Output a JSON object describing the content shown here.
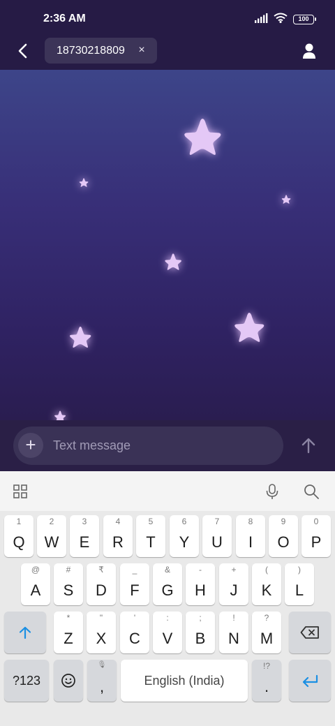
{
  "status_bar": {
    "time": "2:36 AM",
    "battery": "100"
  },
  "header": {
    "recipient": "18730218809",
    "remove_symbol": "×"
  },
  "composer": {
    "placeholder": "Text message",
    "attach_symbol": "+"
  },
  "keyboard": {
    "row1": [
      {
        "main": "Q",
        "hint": "1"
      },
      {
        "main": "W",
        "hint": "2"
      },
      {
        "main": "E",
        "hint": "3"
      },
      {
        "main": "R",
        "hint": "4"
      },
      {
        "main": "T",
        "hint": "5"
      },
      {
        "main": "Y",
        "hint": "6"
      },
      {
        "main": "U",
        "hint": "7"
      },
      {
        "main": "I",
        "hint": "8"
      },
      {
        "main": "O",
        "hint": "9"
      },
      {
        "main": "P",
        "hint": "0"
      }
    ],
    "row2": [
      {
        "main": "A",
        "hint": "@"
      },
      {
        "main": "S",
        "hint": "#"
      },
      {
        "main": "D",
        "hint": "₹"
      },
      {
        "main": "F",
        "hint": "_"
      },
      {
        "main": "G",
        "hint": "&"
      },
      {
        "main": "H",
        "hint": "-"
      },
      {
        "main": "J",
        "hint": "+"
      },
      {
        "main": "K",
        "hint": "("
      },
      {
        "main": "L",
        "hint": ")"
      }
    ],
    "row3": [
      {
        "main": "Z",
        "hint": "*"
      },
      {
        "main": "X",
        "hint": "\""
      },
      {
        "main": "C",
        "hint": "'"
      },
      {
        "main": "V",
        "hint": ":"
      },
      {
        "main": "B",
        "hint": ";"
      },
      {
        "main": "N",
        "hint": "!"
      },
      {
        "main": "M",
        "hint": "?"
      }
    ],
    "symbols_label": "?123",
    "comma": {
      "main": ",",
      "hint": "🎙"
    },
    "space_label": "English (India)",
    "period": {
      "main": ".",
      "hint": "!?"
    }
  },
  "colors": {
    "accent": "#1a8fe3",
    "header": "#261b45",
    "star": "#e4c8f6"
  }
}
